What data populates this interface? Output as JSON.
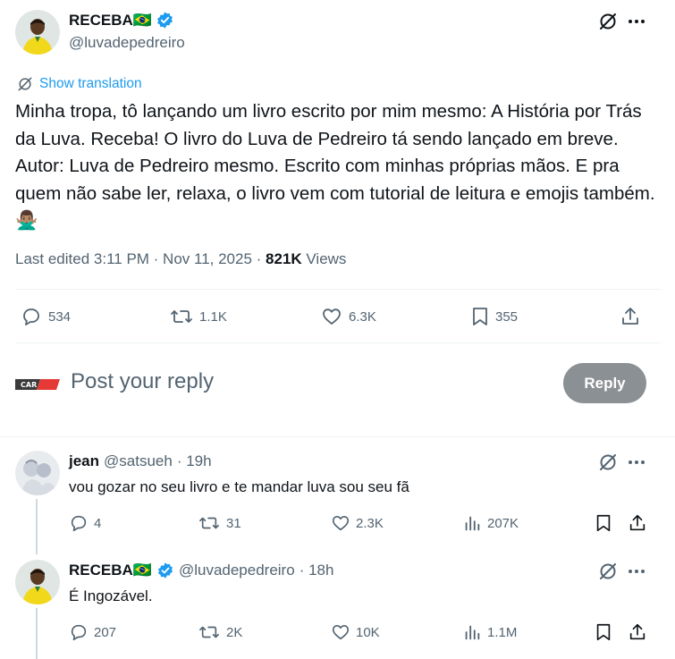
{
  "main_tweet": {
    "display_name": "RECEBA🇧🇷",
    "handle": "@luvadepedreiro",
    "translate_label": "Show translation",
    "text": "Minha tropa, tô lançando um livro escrito por mim mesmo: A História por Trás da Luva. Receba! O livro do Luva de Pedreiro tá sendo lançado em breve. Autor: Luva de Pedreiro mesmo. Escrito com minhas próprias mãos. E pra quem não sabe ler, relaxa, o livro vem com tutorial de leitura e emojis também.🙅🏽‍♂️",
    "timestamp": "Last edited 3:11 PM · Nov 11, 2025 · ",
    "views_count": "821K",
    "views_label": " Views",
    "stats": {
      "replies": "534",
      "reposts": "1.1K",
      "likes": "6.3K",
      "bookmarks": "355"
    }
  },
  "composer": {
    "avatar_text": "CAR",
    "placeholder": "Post your reply",
    "reply_button": "Reply"
  },
  "replies": [
    {
      "display_name": "jean",
      "handle": "@satsueh",
      "time": "· 19h",
      "text": "vou gozar no seu livro e te mandar luva sou seu fã",
      "stats": {
        "replies": "4",
        "reposts": "31",
        "likes": "2.3K",
        "views": "207K"
      }
    },
    {
      "display_name": "RECEBA🇧🇷",
      "handle": "@luvadepedreiro",
      "time": "· 18h",
      "text": "É Ingozável.",
      "stats": {
        "replies": "207",
        "reposts": "2K",
        "likes": "10K",
        "views": "1.1M"
      }
    }
  ],
  "colors": {
    "accent": "#1d9bf0",
    "text_primary": "#0f1419",
    "text_secondary": "#536471",
    "reply_button_disabled": "#8b9094",
    "divider": "#eff3f4"
  },
  "icons": [
    "verified-badge-icon",
    "grok-icon",
    "more-icon",
    "translate-icon",
    "reply-icon",
    "repost-icon",
    "like-icon",
    "bookmark-icon",
    "share-icon",
    "views-icon"
  ]
}
